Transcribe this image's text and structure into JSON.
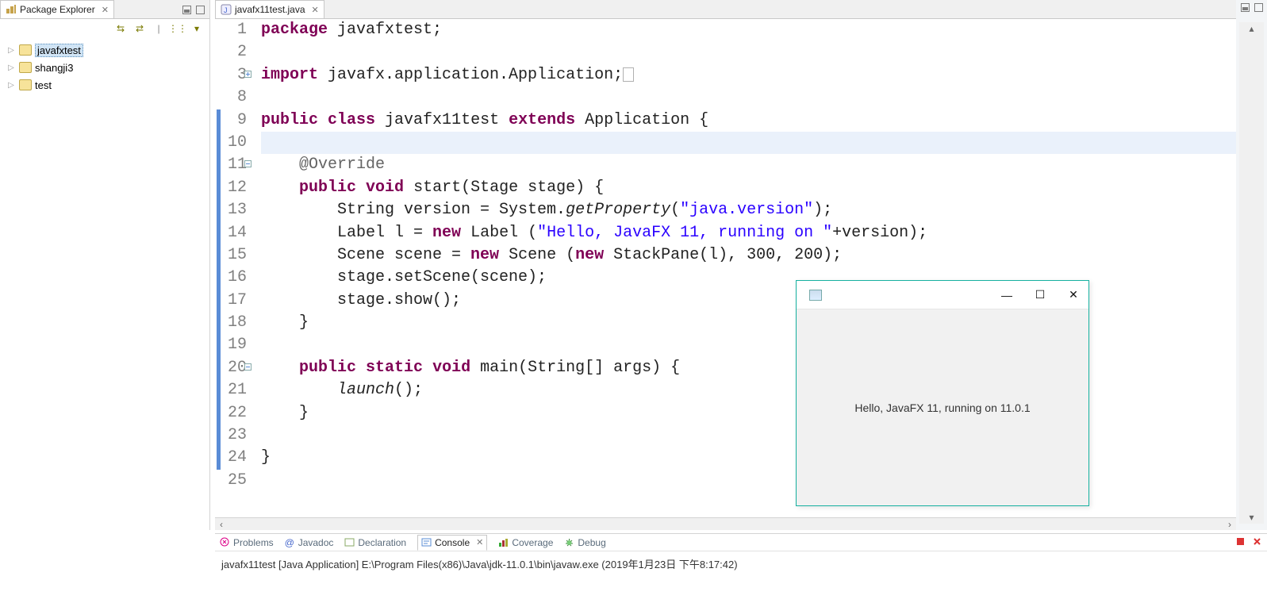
{
  "package_explorer": {
    "title": "Package Explorer",
    "projects": [
      {
        "name": "javafxtest",
        "selected": true
      },
      {
        "name": "shangji3",
        "selected": false
      },
      {
        "name": "test",
        "selected": false
      }
    ]
  },
  "editor": {
    "tab_title": "javafx11test.java",
    "lines": [
      {
        "n": "1"
      },
      {
        "n": "2"
      },
      {
        "n": "3",
        "fold": "plus"
      },
      {
        "n": "8"
      },
      {
        "n": "9",
        "bar": true
      },
      {
        "n": "10",
        "bar": true,
        "hl": true
      },
      {
        "n": "11",
        "bar": true,
        "fold": "minus"
      },
      {
        "n": "12",
        "bar": true
      },
      {
        "n": "13",
        "bar": true
      },
      {
        "n": "14",
        "bar": true
      },
      {
        "n": "15",
        "bar": true
      },
      {
        "n": "16",
        "bar": true
      },
      {
        "n": "17",
        "bar": true
      },
      {
        "n": "18",
        "bar": true
      },
      {
        "n": "19",
        "bar": true
      },
      {
        "n": "20",
        "bar": true,
        "fold": "minus"
      },
      {
        "n": "21",
        "bar": true
      },
      {
        "n": "22",
        "bar": true
      },
      {
        "n": "23",
        "bar": true
      },
      {
        "n": "24",
        "bar": true
      },
      {
        "n": "25"
      }
    ],
    "code": {
      "t_package": "package",
      "pkg_name": " javafxtest;",
      "t_import": "import",
      "import_name": " javafx.application.Application;",
      "t_public": "public",
      "t_class": "class",
      "class_name": " javafx11test ",
      "t_extends": "extends",
      "extends_name": " Application {",
      "override": "@Override",
      "t_void": "void",
      "start_sig": " start(Stage stage) {",
      "l13": "        String version = System.",
      "getProp": "getProperty",
      "l13b": "(",
      "s_javaversion": "\"java.version\"",
      "l13c": ");",
      "l14a": "        Label l = ",
      "t_new": "new",
      "l14b": " Label (",
      "s_hello": "\"Hello, JavaFX 11, running on \"",
      "l14c": "+version);",
      "l15a": "        Scene scene = ",
      "l15b": " Scene (",
      "l15c": " StackPane(l), 300, 200);",
      "l16": "        stage.setScene(scene);",
      "l17": "        stage.show();",
      "l18": "    }",
      "t_static": "static",
      "main_sig": " main(String[] args) {",
      "l21a": "        ",
      "launch": "launch",
      "l21b": "();",
      "l22": "    }",
      "l24": "}"
    }
  },
  "console": {
    "tabs": {
      "problems": "Problems",
      "javadoc": "Javadoc",
      "declaration": "Declaration",
      "console": "Console",
      "coverage": "Coverage",
      "debug": "Debug"
    },
    "info": "javafx11test [Java Application] E:\\Program Files(x86)\\Java\\jdk-11.0.1\\bin\\javaw.exe (2019年1月23日 下午8:17:42)"
  },
  "fx_window": {
    "content": "Hello, JavaFX 11, running on 11.0.1"
  }
}
